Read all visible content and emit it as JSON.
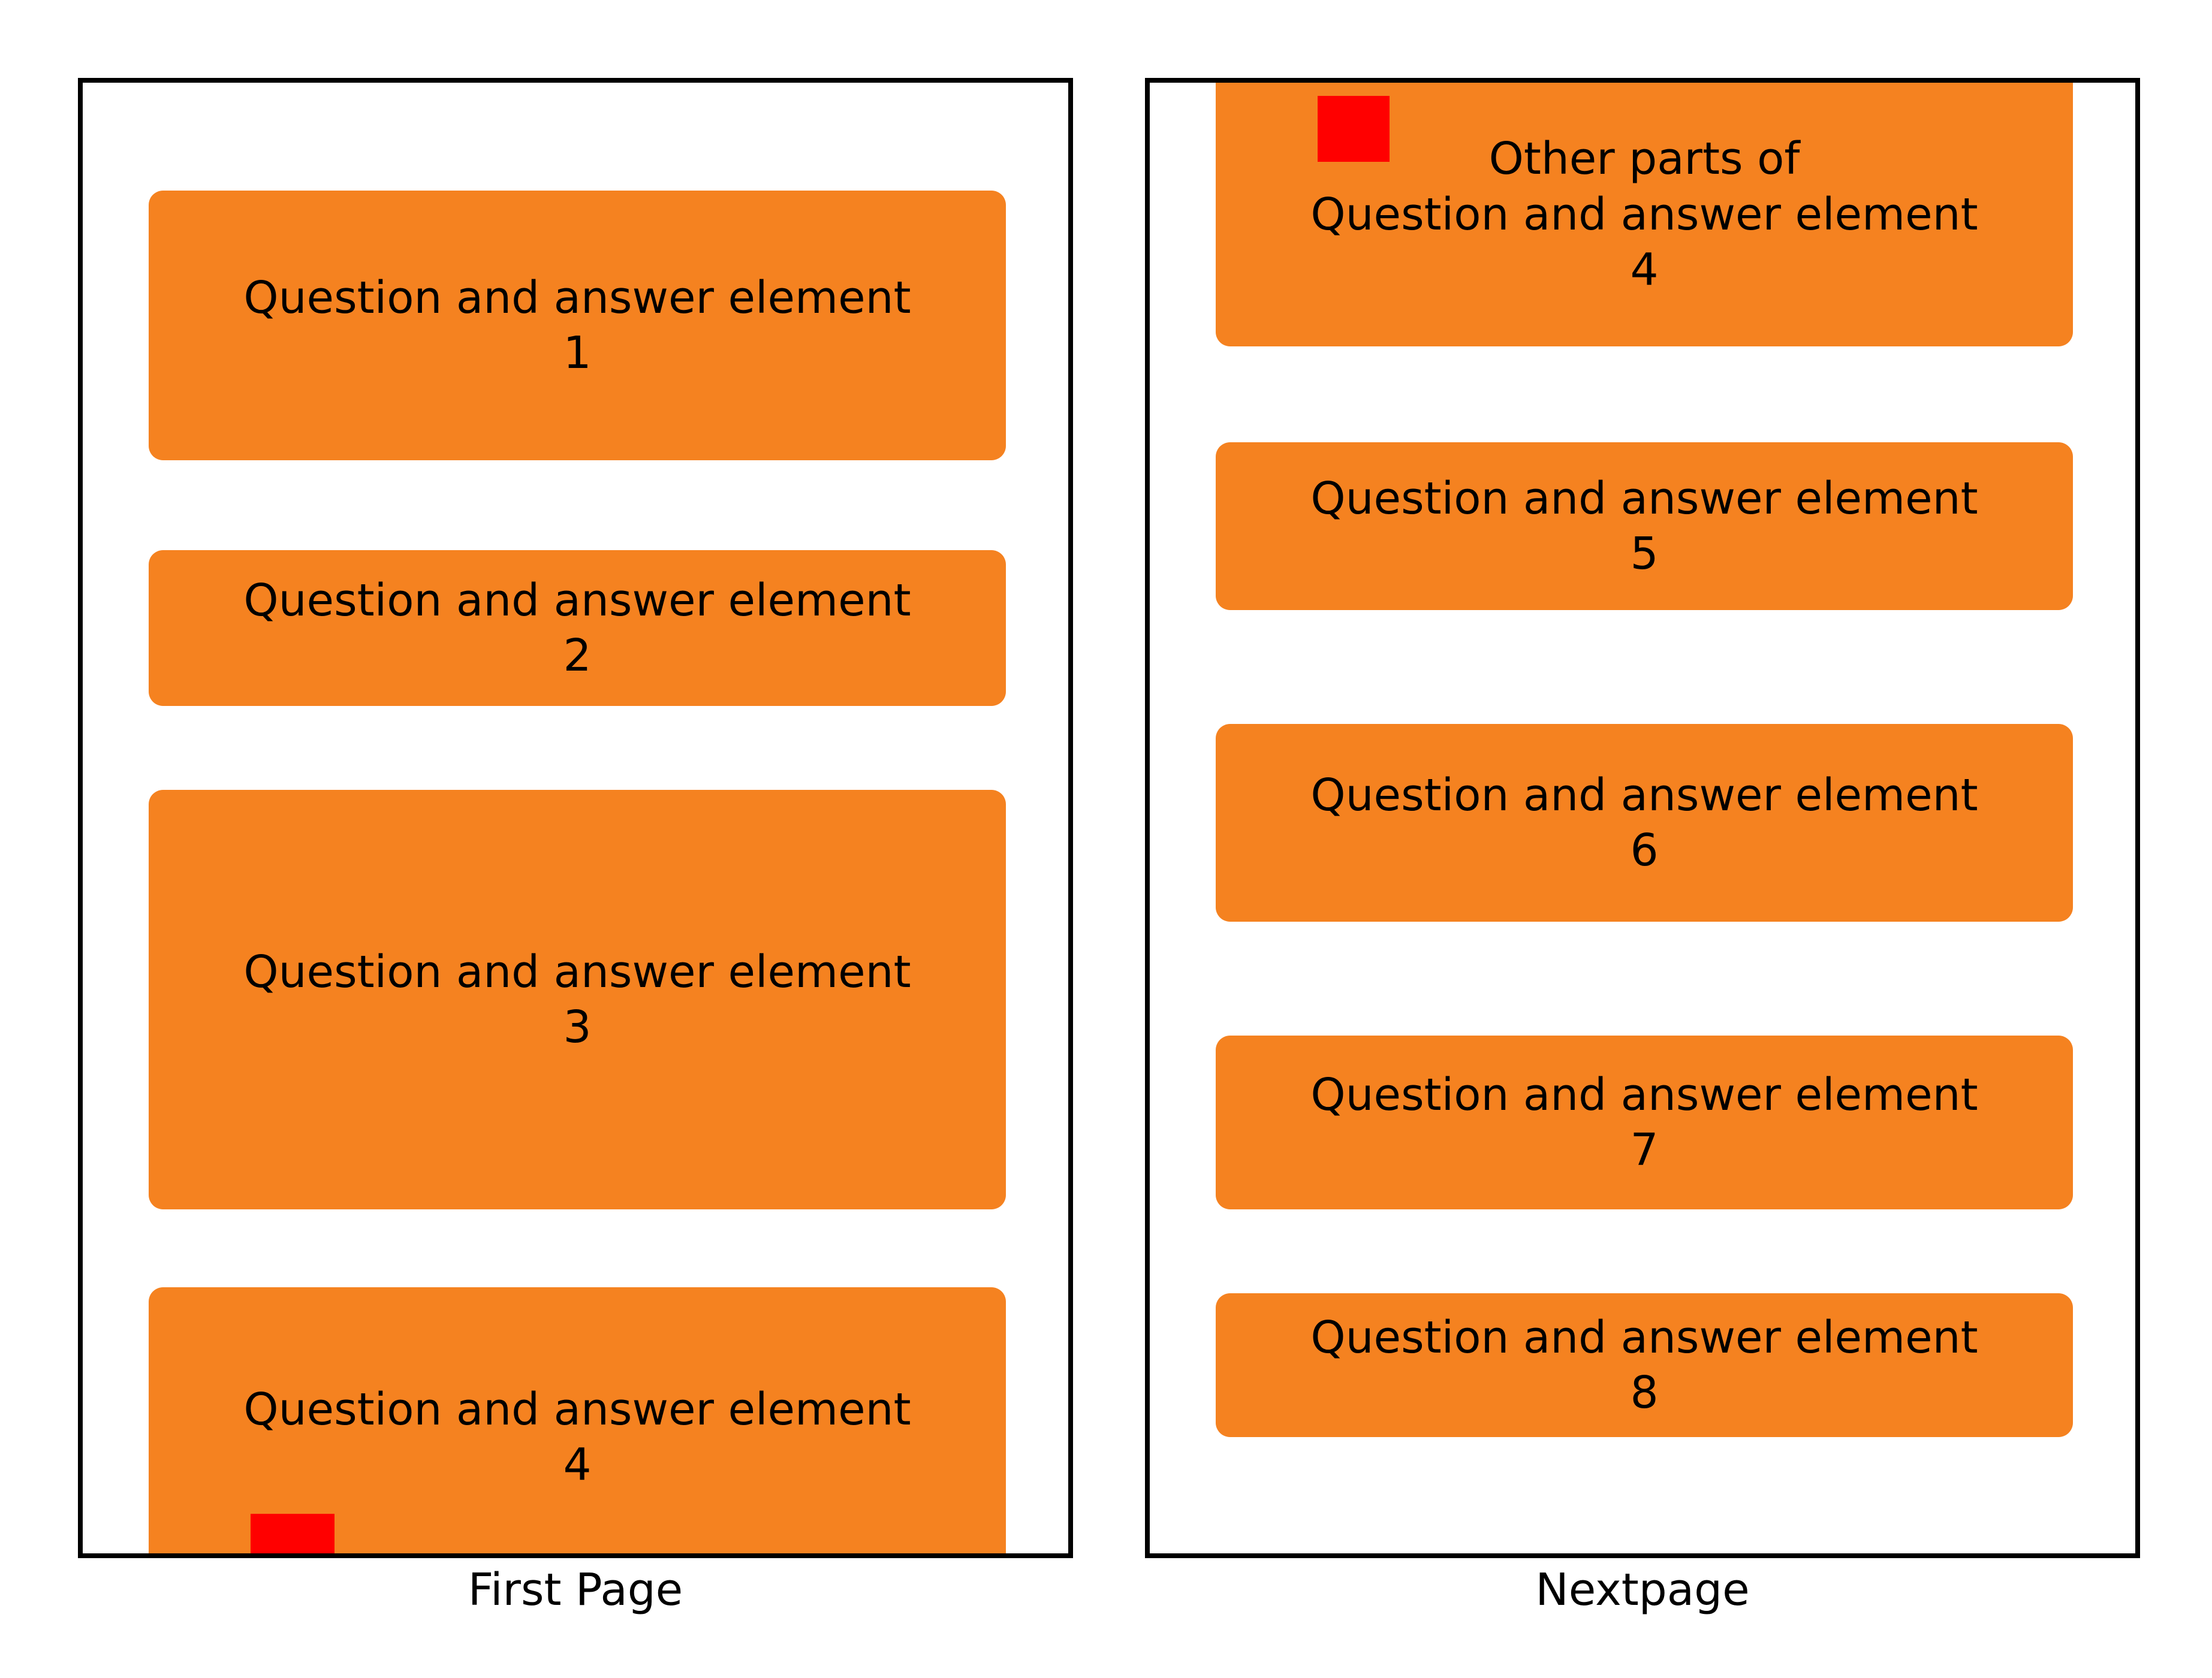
{
  "labels": {
    "first_page": "First Page",
    "next_page": "Nextpage"
  },
  "colors": {
    "block_fill": "#f58220",
    "marker_fill": "#ff0000",
    "page_border": "#000000"
  },
  "page1": {
    "items": [
      {
        "line1": "Question and answer element",
        "line2": "1"
      },
      {
        "line1": "Question and answer element",
        "line2": "2"
      },
      {
        "line1": "Question and answer element",
        "line2": "3"
      },
      {
        "line1": "Question and answer element",
        "line2": "4"
      }
    ]
  },
  "page2": {
    "continued_item": {
      "line1": "Other parts of",
      "line2": "Question and answer element",
      "line3": "4"
    },
    "items": [
      {
        "line1": "Question and answer element",
        "line2": "5"
      },
      {
        "line1": "Question and answer element",
        "line2": "6"
      },
      {
        "line1": "Question and answer element",
        "line2": "7"
      },
      {
        "line1": "Question and answer element",
        "line2": "8"
      }
    ]
  }
}
